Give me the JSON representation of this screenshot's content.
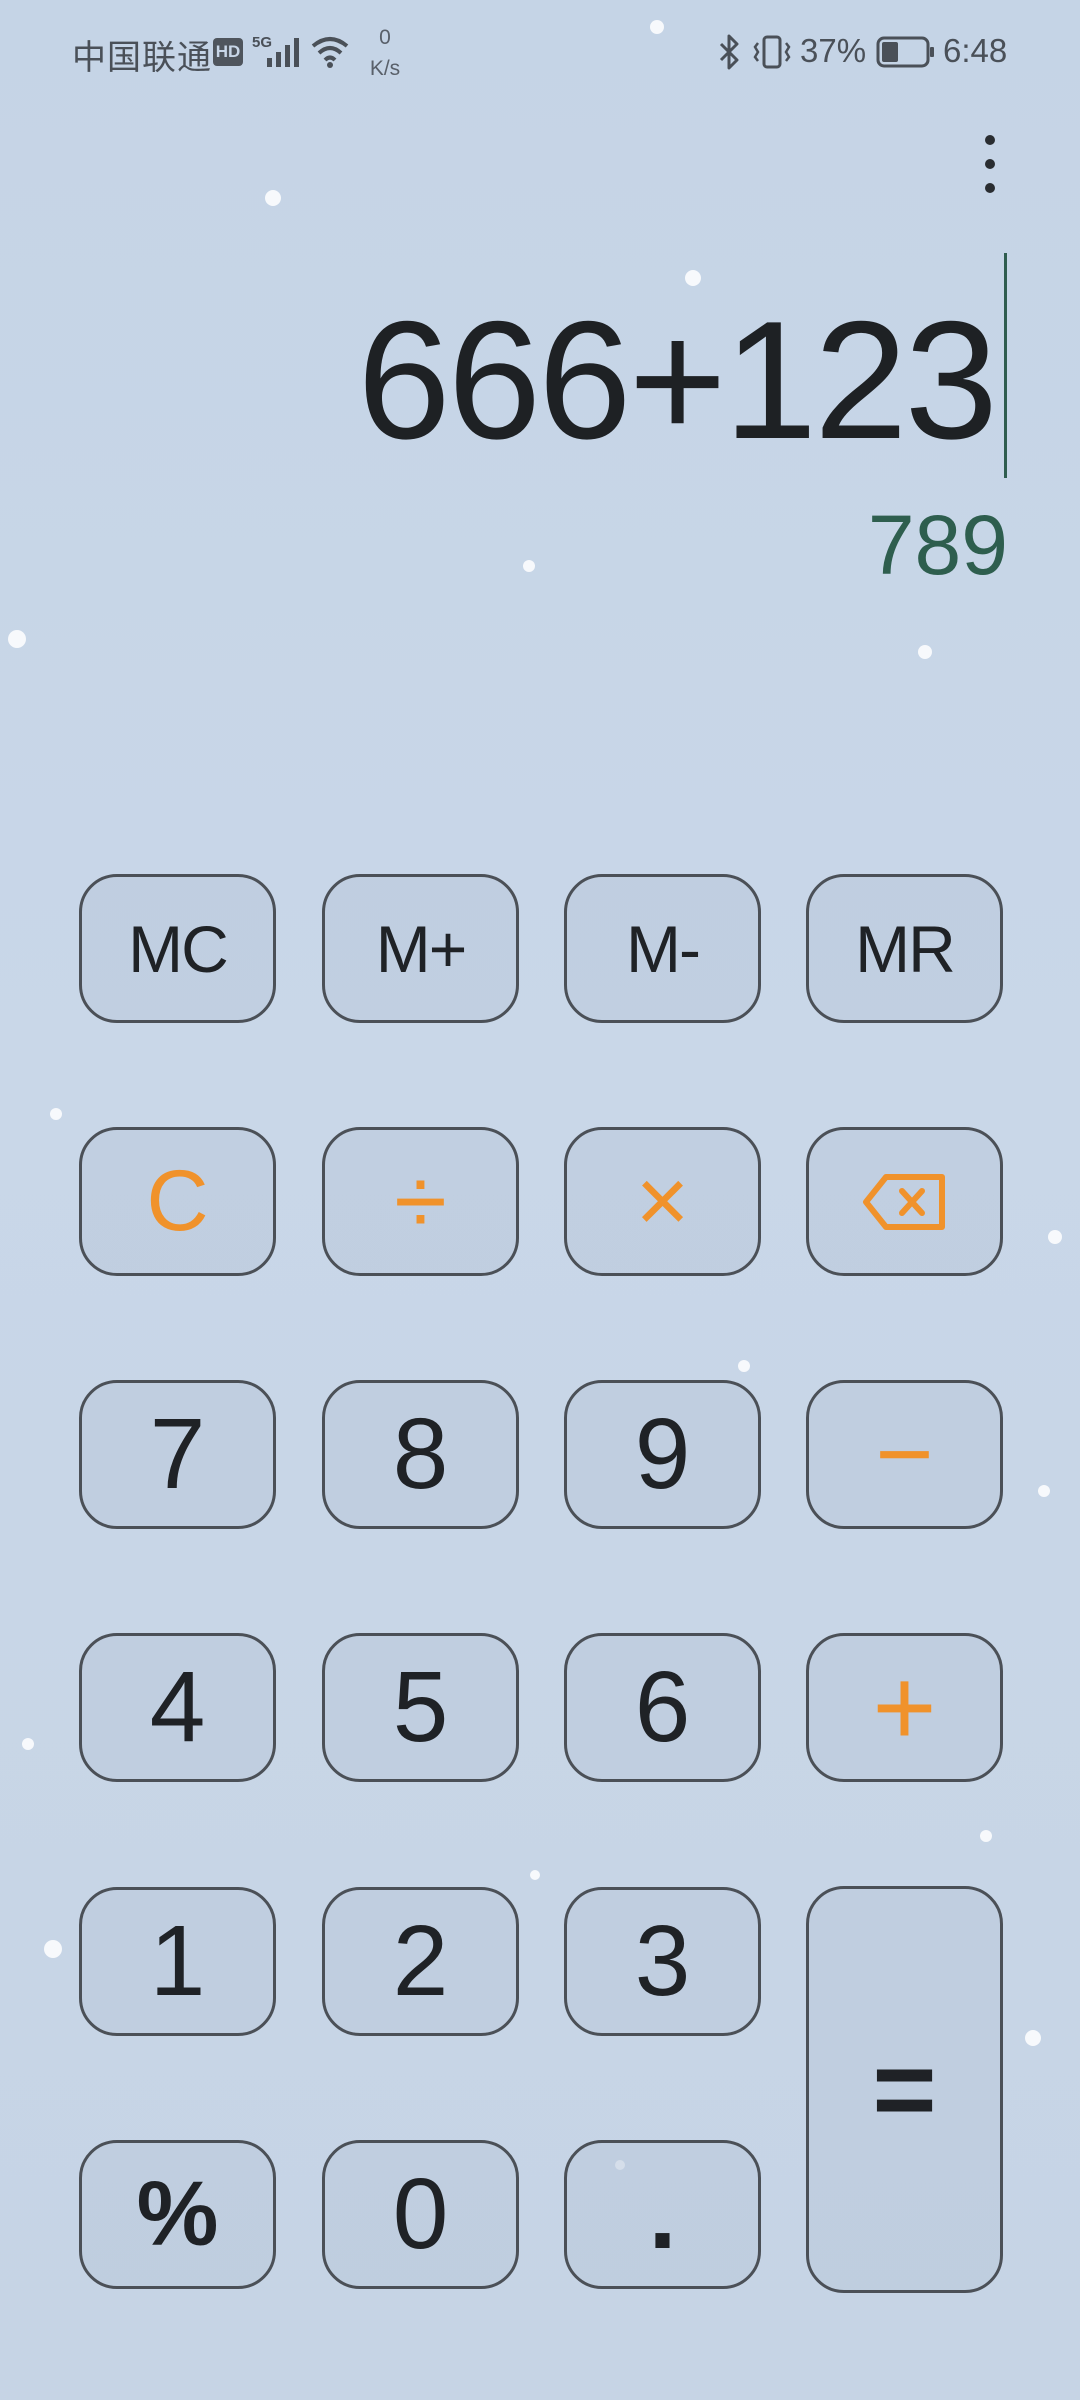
{
  "status_bar": {
    "carrier": "中国联通",
    "hd_badge": "HD",
    "network_generation": "5G",
    "net_speed_value": "0",
    "net_speed_unit": "K/s",
    "battery_percent": "37%",
    "battery_level": 0.37,
    "time": "6:48",
    "icons": [
      "signal-icon",
      "wifi-icon",
      "bluetooth-icon",
      "vibrate-icon",
      "battery-icon"
    ]
  },
  "display": {
    "more_menu_icon": "more-vertical-icon",
    "expression": "666+123",
    "result": "789"
  },
  "keypad": {
    "memory_clear": "MC",
    "memory_add": "M+",
    "memory_subtract": "M-",
    "memory_recall": "MR",
    "clear": "C",
    "divide": "÷",
    "multiply": "×",
    "backspace_icon": "backspace-icon",
    "seven": "7",
    "eight": "8",
    "nine": "9",
    "subtract": "−",
    "four": "4",
    "five": "5",
    "six": "6",
    "add": "+",
    "one": "1",
    "two": "2",
    "three": "3",
    "equals": "=",
    "percent": "%",
    "zero": "0",
    "decimal": "."
  },
  "colors": {
    "background": "#c8d6e7",
    "operator_accent": "#f0922b",
    "result_text": "#2e5e4e",
    "key_border": "#4b5057",
    "digit_text": "#1f2226"
  }
}
